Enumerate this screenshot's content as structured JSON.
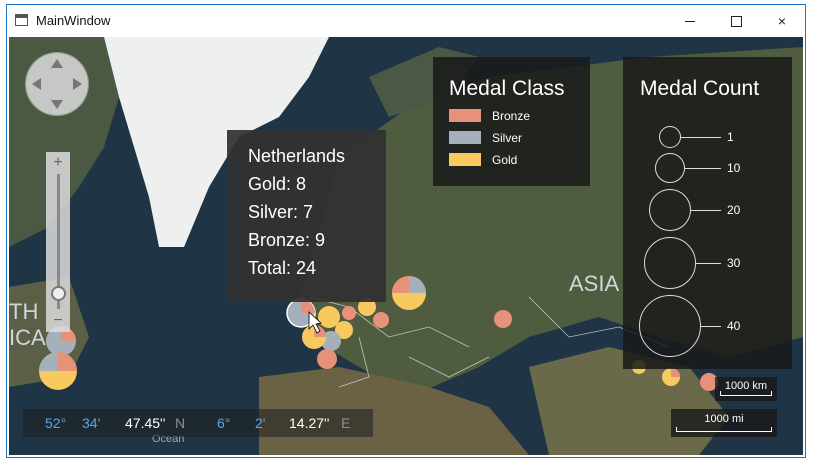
{
  "window": {
    "title": "MainWindow",
    "controls": {
      "minimize": "minimize-icon",
      "maximize": "maximize-icon",
      "close": "×"
    }
  },
  "map": {
    "labels": {
      "asia": "ASIA",
      "america_partial": "TH",
      "america_partial2": "ICA",
      "ocean": "Ocean"
    },
    "coordinates": {
      "lat_deg": "52°",
      "lat_min": "34'",
      "lat_sec": "47.45''",
      "lat_dir": "N",
      "lon_deg": "6°",
      "lon_min": "2'",
      "lon_sec": "14.27''",
      "lon_dir": "E"
    },
    "zoom": {
      "plus": "+",
      "minus": "−"
    }
  },
  "tooltip": {
    "country": "Netherlands",
    "gold": "Gold: 8",
    "silver": "Silver: 7",
    "bronze": "Bronze: 9",
    "total": "Total: 24"
  },
  "legend_class": {
    "title": "Medal Class",
    "items": [
      {
        "label": "Bronze",
        "color": "#e8917a"
      },
      {
        "label": "Silver",
        "color": "#a4b1ba"
      },
      {
        "label": "Gold",
        "color": "#f8c95f"
      }
    ]
  },
  "legend_count": {
    "title": "Medal Count",
    "items": [
      {
        "label": "1"
      },
      {
        "label": "10"
      },
      {
        "label": "20"
      },
      {
        "label": "30"
      },
      {
        "label": "40"
      }
    ]
  },
  "scale": {
    "km": "1000 km",
    "mi": "1000 mi"
  },
  "colors": {
    "bronze": "#e8917a",
    "silver": "#a4b1ba",
    "gold": "#f8c95f",
    "water": "#23394a",
    "land": "#4e5a3e",
    "ice": "#f4f4f4"
  }
}
